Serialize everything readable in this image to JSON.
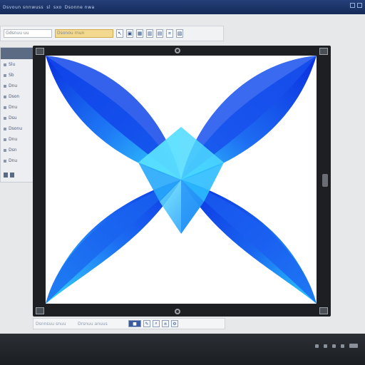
{
  "window": {
    "menu": [
      "Dsvoun snnwuss",
      "sl",
      "sxo",
      "Dsonne nwa"
    ]
  },
  "toolbar": {
    "field_1": "Gdsnuu uu",
    "field_2": "Dsonou rnun",
    "icons": [
      "cursor-icon",
      "image-icon",
      "grid-icon",
      "chart-icon",
      "layers-icon",
      "crop-icon",
      "export-icon"
    ]
  },
  "sidebar": {
    "items": [
      "Slu",
      "Sb",
      "Dnu",
      "Dson",
      "Dnu",
      "Dsu",
      "Dsonu",
      "Dnu",
      "Dsn",
      "Dnu"
    ]
  },
  "canvas": {
    "artwork": "blue-star-shape",
    "colors": {
      "deep": "#0a2fe0",
      "mid": "#1f7cf5",
      "light": "#32d8ff",
      "background": "#ffffff"
    }
  },
  "status": {
    "text_1": "Dsnnsuu snuu",
    "text_2": "Drsnuu anuus",
    "icons": [
      "page-icon",
      "marker-icon",
      "search-icon",
      "zoom-icon",
      "settings-icon"
    ]
  }
}
